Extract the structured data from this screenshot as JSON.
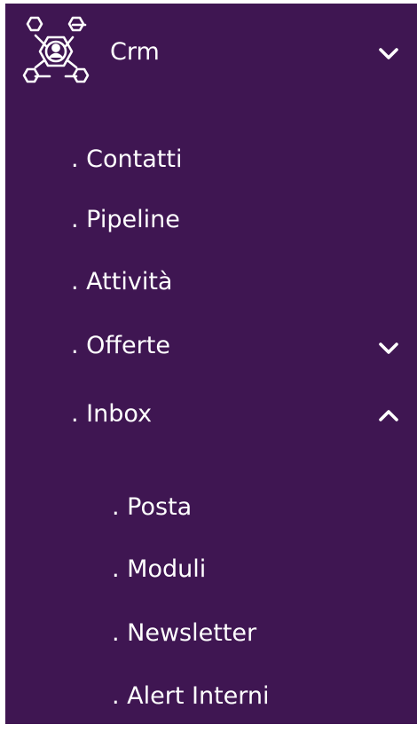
{
  "crm": {
    "title": "Crm",
    "logo_icon": "crm-network-user-icon",
    "toggle_icon": "chevron-down-icon"
  },
  "menu": {
    "items": [
      {
        "label": ". Contatti"
      },
      {
        "label": ". Pipeline"
      },
      {
        "label": ". Attività"
      },
      {
        "label": ". Offerte",
        "toggle_icon": "chevron-down-icon"
      },
      {
        "label": ". Inbox",
        "toggle_icon": "chevron-up-icon"
      }
    ],
    "inbox_subitems": [
      {
        "label": ". Posta"
      },
      {
        "label": ". Moduli"
      },
      {
        "label": ". Newsletter"
      },
      {
        "label": ". Alert Interni"
      }
    ]
  },
  "colors": {
    "sidebar_background": "#3f1652",
    "text": "#ffffff"
  }
}
